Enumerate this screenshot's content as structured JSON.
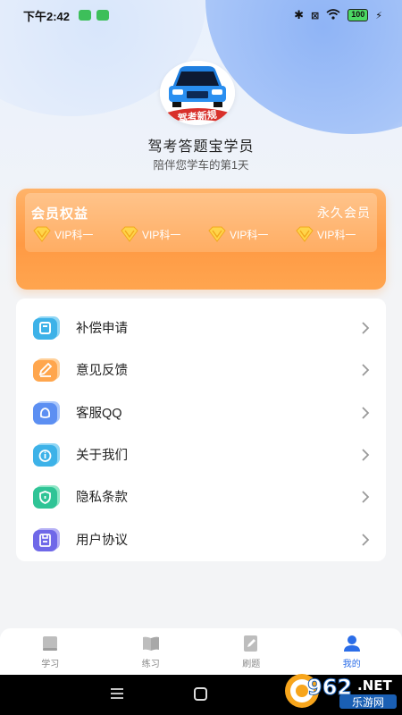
{
  "status_bar": {
    "time": "下午2:42",
    "battery": "100"
  },
  "profile": {
    "avatar_text": "驾考新规",
    "name": "驾考答题宝学员",
    "subtitle": "陪伴您学车的第1天"
  },
  "vip": {
    "title": "会员权益",
    "type": "永久会员",
    "badges": [
      "VIP科一",
      "VIP科一",
      "VIP科一",
      "VIP科一"
    ],
    "color": "#ff9a44"
  },
  "menu": {
    "items": [
      {
        "label": "补偿申请",
        "icon": "refund-icon"
      },
      {
        "label": "意见反馈",
        "icon": "feedback-icon"
      },
      {
        "label": "客服QQ",
        "icon": "qq-icon"
      },
      {
        "label": "关于我们",
        "icon": "info-icon"
      },
      {
        "label": "隐私条款",
        "icon": "shield-icon"
      },
      {
        "label": "用户协议",
        "icon": "document-icon"
      }
    ]
  },
  "tabs": [
    {
      "label": "学习",
      "icon": "book-icon",
      "active": false
    },
    {
      "label": "练习",
      "icon": "open-book-icon",
      "active": false
    },
    {
      "label": "刷题",
      "icon": "edit-icon",
      "active": false
    },
    {
      "label": "我的",
      "icon": "user-icon",
      "active": true
    }
  ],
  "watermark": {
    "text_top": "962",
    "text_net": ".NET",
    "text_bottom": "乐游网"
  },
  "colors": {
    "accent": "#2b6de8",
    "vip_orange": "#ff9a44"
  }
}
